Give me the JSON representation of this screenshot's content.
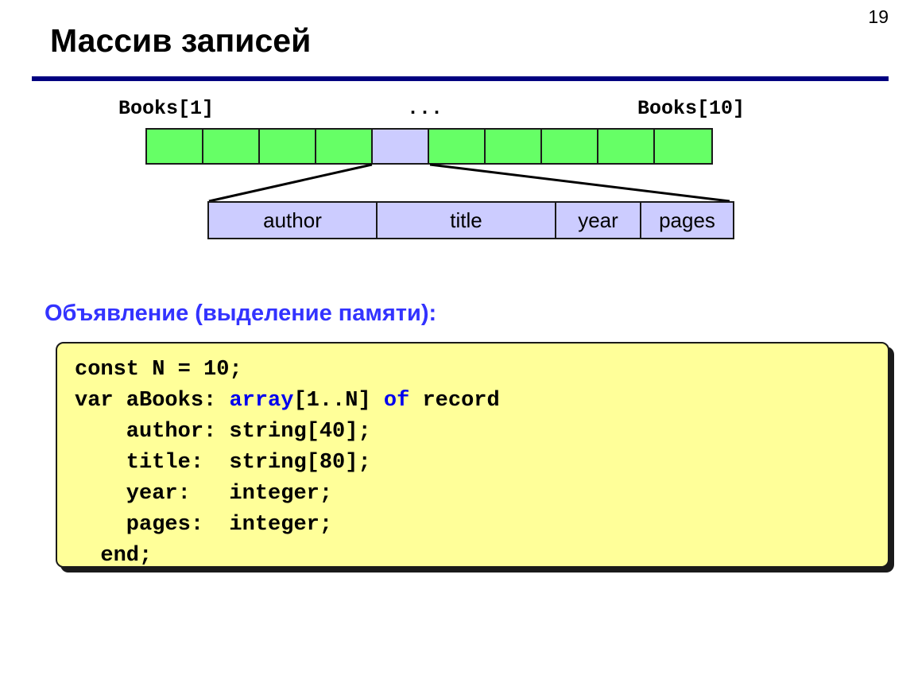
{
  "slide": {
    "number": "19",
    "title": "Массив записей"
  },
  "array_diagram": {
    "label_first": "Books[1]",
    "label_ellipsis": "...",
    "label_last": "Books[10]",
    "cells": [
      {
        "index": 1,
        "color": "#66ff66",
        "highlight": false
      },
      {
        "index": 2,
        "color": "#66ff66",
        "highlight": false
      },
      {
        "index": 3,
        "color": "#66ff66",
        "highlight": false
      },
      {
        "index": 4,
        "color": "#66ff66",
        "highlight": false
      },
      {
        "index": 5,
        "color": "#ccccff",
        "highlight": true
      },
      {
        "index": 6,
        "color": "#66ff66",
        "highlight": false
      },
      {
        "index": 7,
        "color": "#66ff66",
        "highlight": false
      },
      {
        "index": 8,
        "color": "#66ff66",
        "highlight": false
      },
      {
        "index": 9,
        "color": "#66ff66",
        "highlight": false
      },
      {
        "index": 10,
        "color": "#66ff66",
        "highlight": false
      }
    ]
  },
  "record_diagram": {
    "fields": [
      "author",
      "title",
      "year",
      "pages"
    ]
  },
  "section": {
    "heading": "Объявление (выделение памяти):"
  },
  "code": {
    "lines": [
      {
        "segments": [
          {
            "text": "const N = 10;",
            "kw": false
          }
        ]
      },
      {
        "segments": [
          {
            "text": "var aBooks: ",
            "kw": false
          },
          {
            "text": "array",
            "kw": true
          },
          {
            "text": "[1..N] ",
            "kw": false
          },
          {
            "text": "of",
            "kw": true
          },
          {
            "text": " record",
            "kw": false
          }
        ]
      },
      {
        "segments": [
          {
            "text": "    author: string[40];",
            "kw": false
          }
        ]
      },
      {
        "segments": [
          {
            "text": "    title:  string[80];",
            "kw": false
          }
        ]
      },
      {
        "segments": [
          {
            "text": "    year:   integer;",
            "kw": false
          }
        ]
      },
      {
        "segments": [
          {
            "text": "    pages:  integer;",
            "kw": false
          }
        ]
      },
      {
        "segments": [
          {
            "text": "  end;",
            "kw": false
          }
        ]
      }
    ]
  },
  "colors": {
    "rule": "#000080",
    "heading": "#3333ff",
    "keyword": "#0000ee",
    "code_bg": "#ffff99",
    "cell_green": "#66ff66",
    "cell_lavender": "#ccccff"
  }
}
